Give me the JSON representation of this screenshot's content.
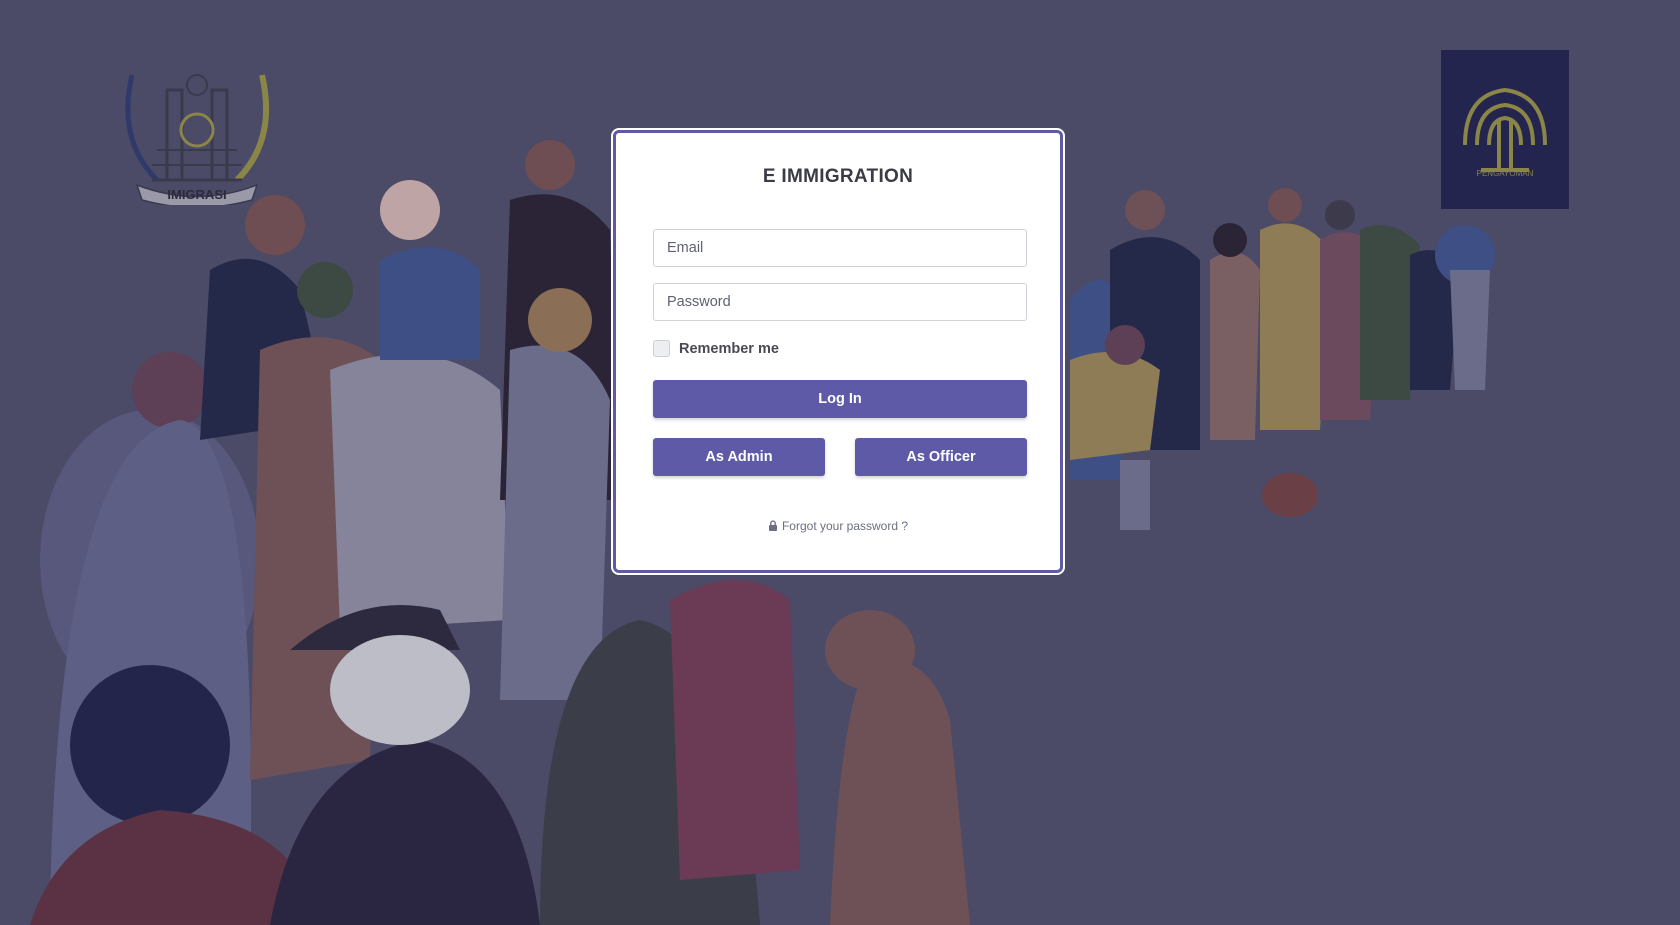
{
  "app": {
    "title": "E IMMIGRATION"
  },
  "logos": {
    "left_text": "IMIGRASI",
    "right_text": "PENGAYOMAN"
  },
  "form": {
    "email_placeholder": "Email",
    "password_placeholder": "Password",
    "remember_label": "Remember me",
    "login_label": "Log In",
    "admin_label": "As Admin",
    "officer_label": "As Officer",
    "forgot_label": "Forgot your password ?"
  },
  "colors": {
    "overlay": "#4b4a67",
    "accent": "#5e5aa8",
    "card_border": "#5f59a8",
    "logo_gold": "#8a8648"
  },
  "icons": {
    "forgot": "lock-icon",
    "remember": "checkbox"
  }
}
